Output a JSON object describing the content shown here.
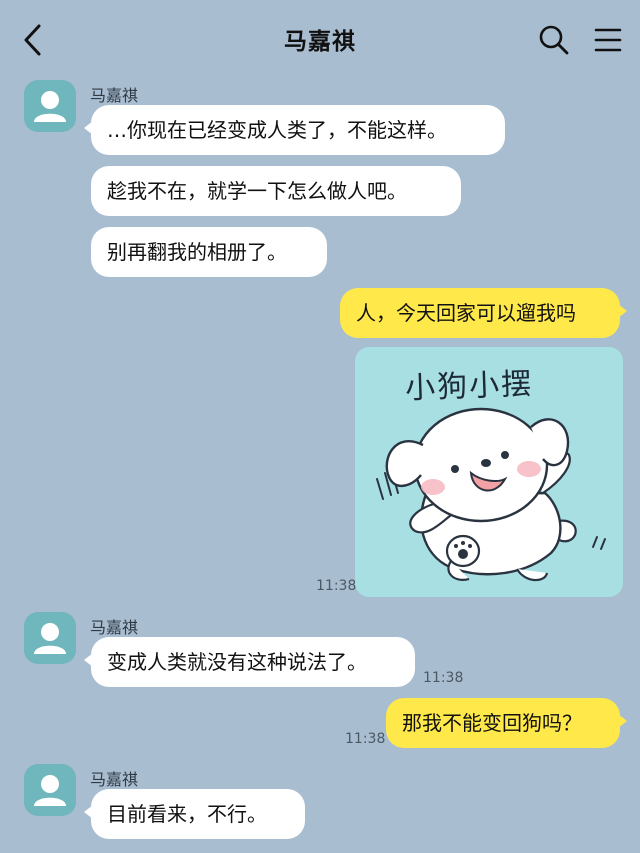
{
  "header": {
    "title": "马嘉祺",
    "back_icon": "chevron-left-icon",
    "search_icon": "search-icon",
    "menu_icon": "hamburger-menu-icon"
  },
  "colors": {
    "background": "#a9bdd1",
    "incoming_bubble": "#ffffff",
    "outgoing_bubble": "#ffe84a",
    "avatar": "#6fb7bd",
    "sticker_background": "#a8dfe3"
  },
  "messages": [
    {
      "sender": "马嘉祺",
      "text": "…你现在已经变成人类了，不能这样。"
    },
    {
      "text": "趁我不在，就学一下怎么做人吧。"
    },
    {
      "text": "别再翻我的相册了。"
    },
    {
      "text": "人，今天回家可以遛我吗"
    },
    {
      "sticker_caption": "小狗小摆",
      "time": "11:38"
    },
    {
      "sender": "马嘉祺",
      "text": "变成人类就没有这种说法了。",
      "time": "11:38"
    },
    {
      "text": "那我不能变回狗吗？",
      "time": "11:38"
    },
    {
      "sender": "马嘉祺",
      "text": "目前看来，不行。"
    }
  ]
}
